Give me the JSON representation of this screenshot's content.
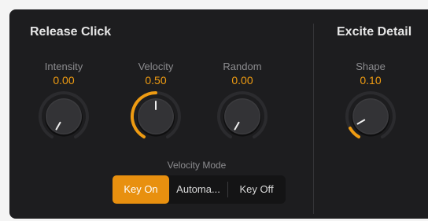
{
  "release_click": {
    "title": "Release Click",
    "intensity": {
      "label": "Intensity",
      "value": "0.00",
      "level": 0.0
    },
    "velocity": {
      "label": "Velocity",
      "value": "0.50",
      "level": 0.5
    },
    "random": {
      "label": "Random",
      "value": "0.00",
      "level": 0.0
    }
  },
  "excite_detail": {
    "title": "Excite Detail",
    "shape": {
      "label": "Shape",
      "value": "0.10",
      "level": 0.1
    }
  },
  "velocity_mode": {
    "label": "Velocity Mode",
    "options": [
      "Key On",
      "Automa...",
      "Key Off"
    ],
    "selected": "Key On"
  },
  "colors": {
    "accent": "#ee9b12",
    "panel_background": "#1d1d1f",
    "label_gray": "#8c8c8f"
  }
}
